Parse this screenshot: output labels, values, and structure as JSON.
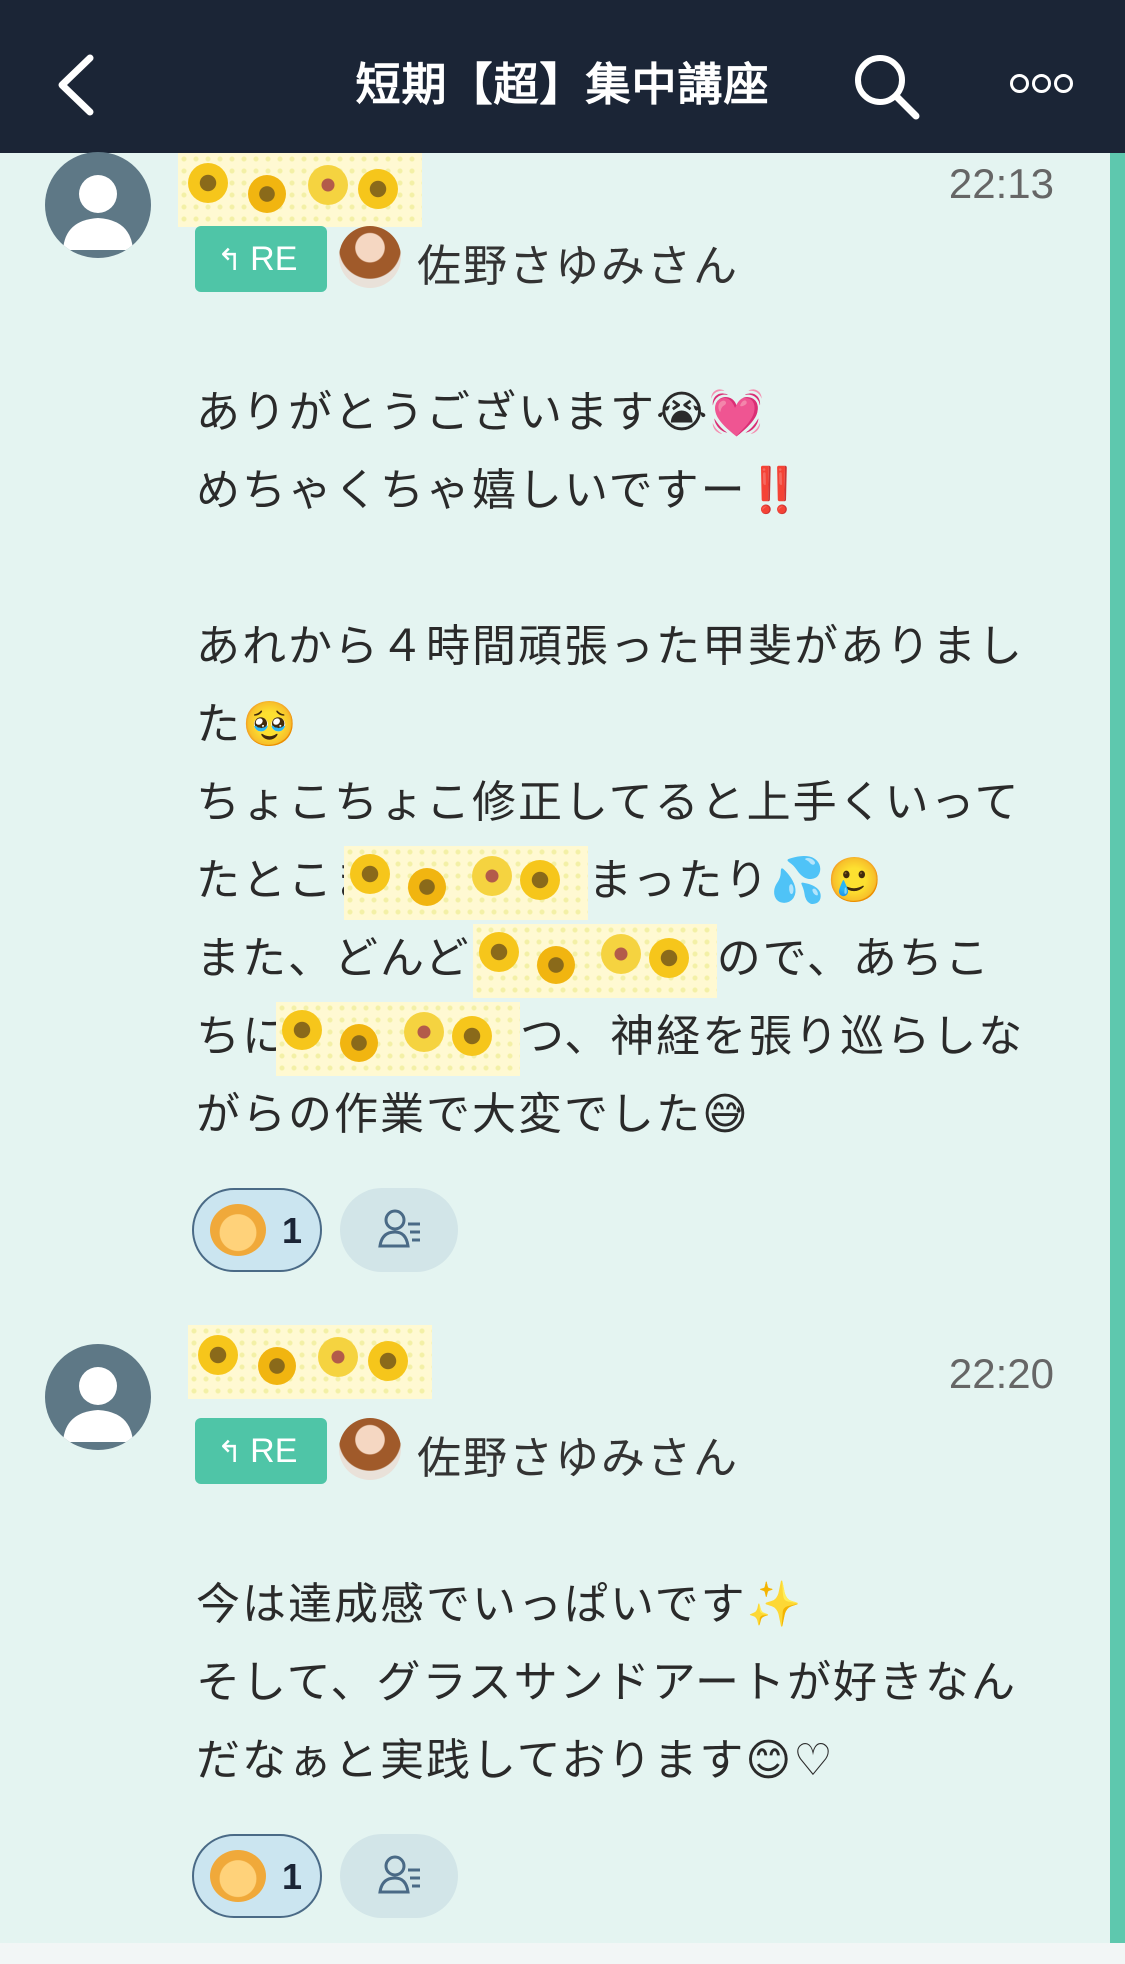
{
  "header": {
    "title": "短期【超】集中講座",
    "back_icon": "chevron-left-icon",
    "search_icon": "search-icon",
    "more_icon": "more-horizontal-icon",
    "background": "#1b2536"
  },
  "accent_color": "#4fc5a7",
  "messages": [
    {
      "time": "22:13",
      "reply_badge": "RE",
      "reply_name": "佐野さゆみさん",
      "lines": [
        "",
        "ありがとうございます😭💓",
        "めちゃくちゃ嬉しいですー‼️",
        "",
        "あれから４時間頑張った甲斐がありまし",
        "た🥹",
        "ちょこちょこ修正してると上手くいって"
      ],
      "line_hl_1_pre": "たとこま",
      "line_hl_1_post": "まったり💦🥲",
      "line_hl_2_pre": "また、どんどん",
      "line_hl_2_post": "ので、あちこ",
      "line_hl_3_pre": "ちに",
      "line_hl_3_post": "つ、神経を張り巡らしな",
      "last_line": "がらの作業で大変でした😅",
      "reaction_count": "1"
    },
    {
      "time": "22:20",
      "reply_badge": "RE",
      "reply_name": "佐野さゆみさん",
      "lines": [
        "",
        "今は達成感でいっぱいです✨",
        "そして、グラスサンドアートが好きなん",
        "だなぁと実践しております😊♡"
      ],
      "reaction_count": "1"
    }
  ]
}
